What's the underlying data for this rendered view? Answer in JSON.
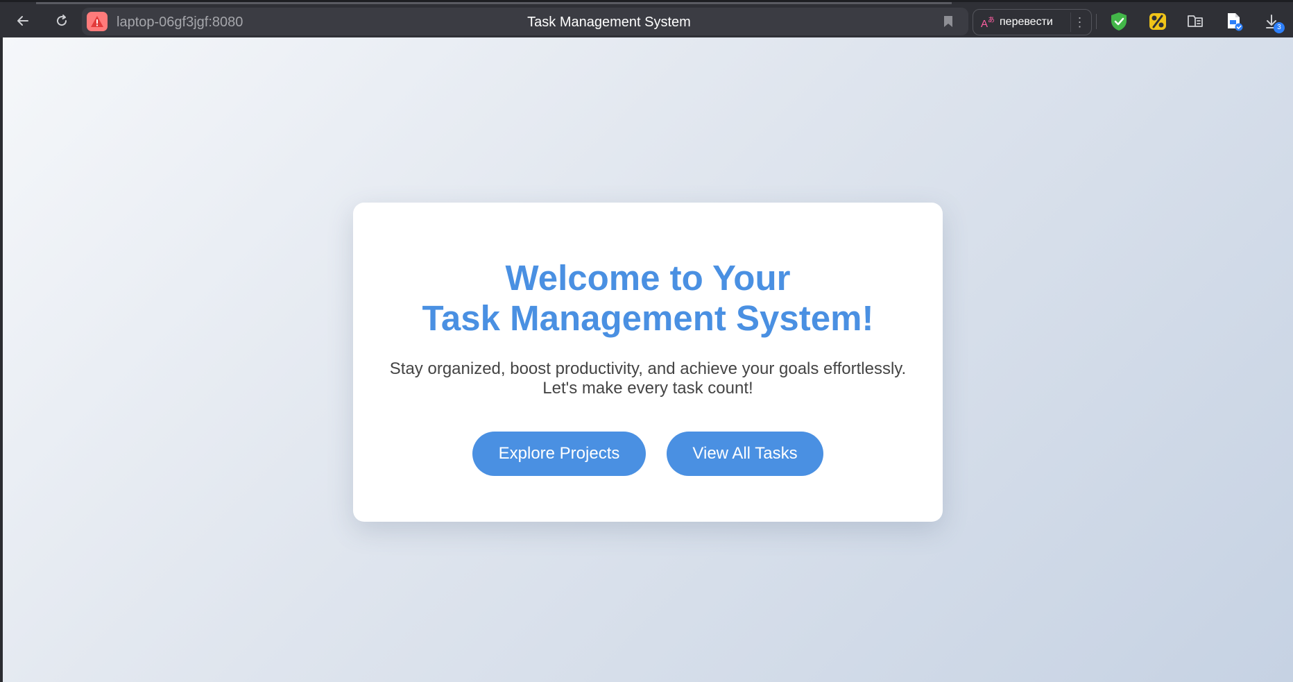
{
  "browser": {
    "url": "laptop-06gf3jgf:8080",
    "tab_title": "Task Management System",
    "translate_label": "перевести",
    "translate_menu": "⋮",
    "downloads_count": "3"
  },
  "colors": {
    "accent": "#4a90e2",
    "warning_badge": "#ff7b7b",
    "shield_green": "#43b649",
    "percent_gold": "#f0c419",
    "download_badge": "#2d7ff9"
  },
  "icons": {
    "back": "arrow-left",
    "reload": "refresh",
    "site_warning": "warning-triangle",
    "bookmark": "bookmark",
    "translate": "translate",
    "protect": "shield-check",
    "discount": "percent",
    "tab_groups": "tabs",
    "document": "document-check",
    "downloads": "download"
  },
  "hero": {
    "title_line1": "Welcome to Your",
    "title_line2": "Task Management System!",
    "subtitle_line1": "Stay organized, boost productivity, and achieve your goals effortlessly.",
    "subtitle_line2": "Let's make every task count!",
    "primary_button": "Explore Projects",
    "secondary_button": "View All Tasks"
  }
}
